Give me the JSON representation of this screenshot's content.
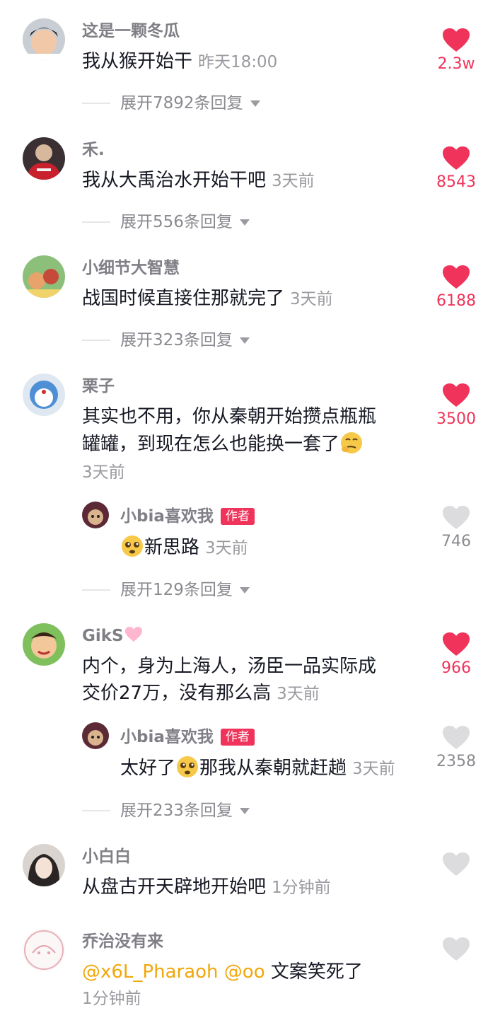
{
  "comments": [
    {
      "name": "这是一颗冬瓜",
      "text": "我从猴开始干",
      "time": "昨天18:00",
      "likes": "2.3w",
      "expand": "展开7892条回复"
    },
    {
      "name": "禾.",
      "text": "我从大禹治水开始干吧",
      "time": "3天前",
      "likes": "8543",
      "expand": "展开556条回复"
    },
    {
      "name": "小细节大智慧",
      "text": "战国时候直接住那就完了",
      "time": "3天前",
      "likes": "6188",
      "expand": "展开323条回复"
    },
    {
      "name": "栗子",
      "text_line1": "其实也不用，你从秦朝开始攒点瓶瓶",
      "text_line2": "罐罐，到现在怎么也能换一套了",
      "time": "3天前",
      "likes": "3500",
      "expand": "展开129条回复",
      "reply": {
        "name": "小bia喜欢我",
        "badge": "作者",
        "text": "新思路",
        "time": "3天前",
        "likes": "746"
      }
    },
    {
      "name": "GikS",
      "text_line1": "内个，身为上海人，汤臣一品实际成",
      "text_line2": "交价27万，没有那么高",
      "time": "3天前",
      "likes": "966",
      "expand": "展开233条回复",
      "reply": {
        "name": "小bia喜欢我",
        "badge": "作者",
        "text_a": "太好了",
        "text_b": "那我从秦朝就赶趟",
        "time": "3天前",
        "likes": "2358"
      }
    },
    {
      "name": "小白白",
      "text": "从盘古开天辟地开始吧",
      "time": "1分钟前"
    },
    {
      "name": "乔治没有来",
      "mention1": "@x6L_Pharaoh",
      "mention2": "@oo",
      "text": "文案笑死了",
      "time": "1分钟前"
    }
  ],
  "colors": {
    "like_red": "#f0335a",
    "like_gray": "#dcdcde",
    "mention": "#f2a70a"
  },
  "icons": {
    "like": "heart-icon",
    "expand": "caret-down-icon"
  }
}
